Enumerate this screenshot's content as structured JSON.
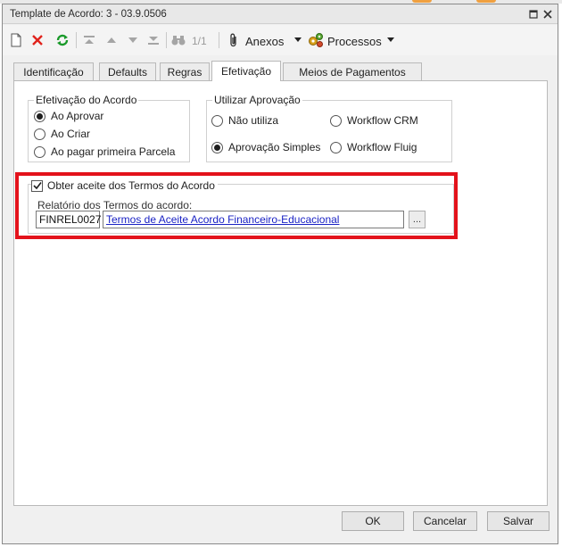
{
  "window": {
    "title": "Template de Acordo: 3 - 03.9.0506",
    "controls": [
      "restore-icon",
      "close-icon"
    ]
  },
  "toolbar": {
    "pager": "1/1",
    "anexos_label": "Anexos",
    "processos_label": "Processos",
    "icons": [
      "new-document-icon",
      "delete-icon",
      "refresh-icon",
      "first-record-icon",
      "previous-record-icon",
      "next-record-icon",
      "last-record-icon",
      "binoculars-icon",
      "paperclip-icon",
      "gears-icon"
    ]
  },
  "tabs": [
    {
      "label": "Identificação",
      "active": false
    },
    {
      "label": "Defaults",
      "active": false
    },
    {
      "label": "Regras",
      "active": false
    },
    {
      "label": "Efetivação",
      "active": true
    },
    {
      "label": "Meios de Pagamentos",
      "active": false
    }
  ],
  "efetivacao": {
    "title": "Efetivação do Acordo",
    "options": [
      {
        "label": "Ao Aprovar",
        "selected": true
      },
      {
        "label": "Ao Criar",
        "selected": false
      },
      {
        "label": "Ao pagar primeira Parcela",
        "selected": false
      }
    ]
  },
  "aprovacao": {
    "title": "Utilizar Aprovação",
    "options": [
      {
        "label": "Não utiliza",
        "selected": false
      },
      {
        "label": "Workflow CRM",
        "selected": false
      },
      {
        "label": "Aprovação Simples",
        "selected": true
      },
      {
        "label": "Workflow Fluig",
        "selected": false
      }
    ]
  },
  "termos": {
    "checkbox_label": "Obter aceite dos Termos do Acordo",
    "checked": true,
    "report_label": "Relatório dos Termos do acordo:",
    "report_code": "FINREL0027",
    "report_name": "Termos de Aceite Acordo Financeiro-Educacional",
    "browse_label": "...",
    "highlight_color": "#e3121b"
  },
  "footer": {
    "ok_label": "OK",
    "cancel_label": "Cancelar",
    "save_label": "Salvar"
  }
}
